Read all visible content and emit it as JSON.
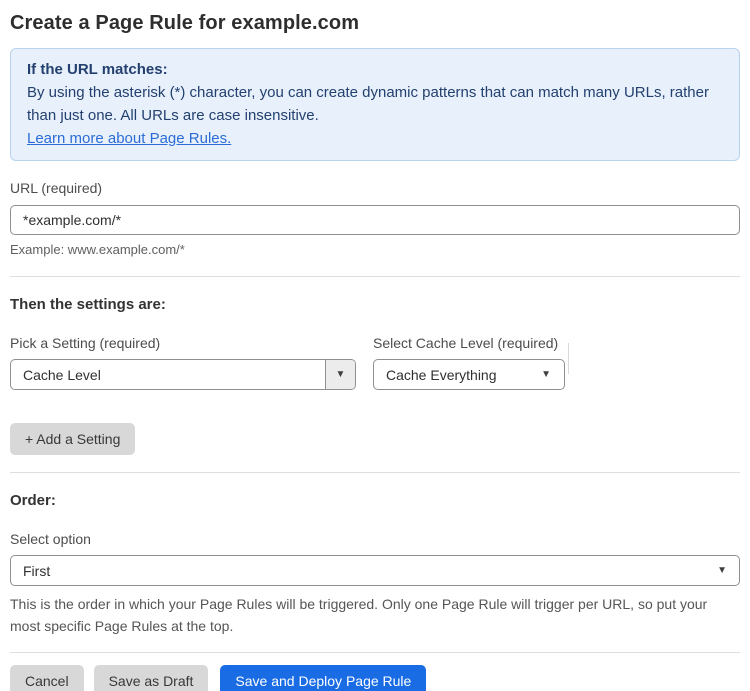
{
  "page": {
    "title": "Create a Page Rule for example.com"
  },
  "info_box": {
    "heading": "If the URL matches:",
    "body": "By using the asterisk (*) character, you can create dynamic patterns that can match many URLs, rather than just one. All URLs are case insensitive.",
    "link_text": "Learn more about Page Rules."
  },
  "url_field": {
    "label": "URL (required)",
    "value": "*example.com/*",
    "helper": "Example: www.example.com/*"
  },
  "settings_section": {
    "heading": "Then the settings are:",
    "setting_picker": {
      "label": "Pick a Setting (required)",
      "selected_value": "Cache Level"
    },
    "cache_level_picker": {
      "label": "Select Cache Level (required)",
      "selected_value": "Cache Everything"
    },
    "add_setting_button": "+ Add a Setting"
  },
  "order_section": {
    "heading": "Order:",
    "label": "Select option",
    "selected_value": "First",
    "helper": "This is the order in which your Page Rules will be triggered. Only one Page Rule will trigger per URL, so put your most specific Page Rules at the top."
  },
  "actions": {
    "cancel_label": "Cancel",
    "save_draft_label": "Save as Draft",
    "save_deploy_label": "Save and Deploy Page Rule"
  },
  "icons": {
    "dropdown_arrow": "▼"
  },
  "colors": {
    "info_box_background": "#e8f1fb",
    "info_box_border": "#b9d3ef",
    "info_text": "#23406f",
    "link_blue": "#2c6cd6",
    "primary_button_blue": "#1a6ce4",
    "secondary_button_gray": "#d8d8d8"
  }
}
